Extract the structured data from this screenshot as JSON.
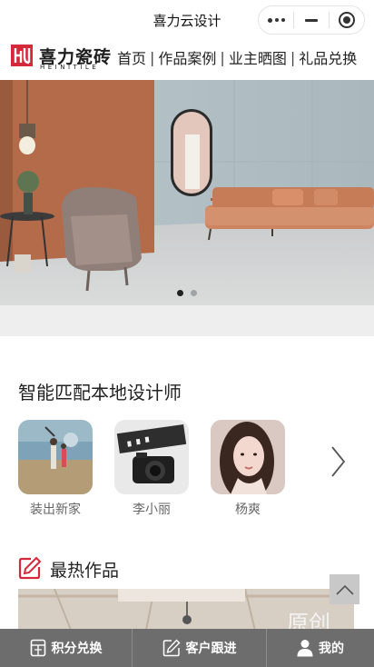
{
  "window": {
    "title": "喜力云设计"
  },
  "brand": {
    "name_cn": "喜力瓷砖",
    "name_en": "HEINITILE"
  },
  "nav": {
    "items": [
      {
        "label": "首页"
      },
      {
        "label": "作品案例"
      },
      {
        "label": "业主晒图"
      },
      {
        "label": "礼品兑换"
      }
    ],
    "separator": "|"
  },
  "banner": {
    "slides": 2,
    "active_slide": 1
  },
  "designers": {
    "title": "智能匹配本地设计师",
    "items": [
      {
        "name": "装出新家"
      },
      {
        "name": "李小丽"
      },
      {
        "name": "杨爽"
      }
    ]
  },
  "hot_works": {
    "title": "最热作品",
    "preview_text": "原创"
  },
  "bottom_bar": {
    "tabs": [
      {
        "label": "积分兑换",
        "icon": "gift-card-icon"
      },
      {
        "label": "客户跟进",
        "icon": "edit-icon"
      },
      {
        "label": "我的",
        "icon": "user-icon"
      }
    ]
  },
  "colors": {
    "brand_red": "#d6283b",
    "bottom_bar": "#6d6d6d"
  }
}
